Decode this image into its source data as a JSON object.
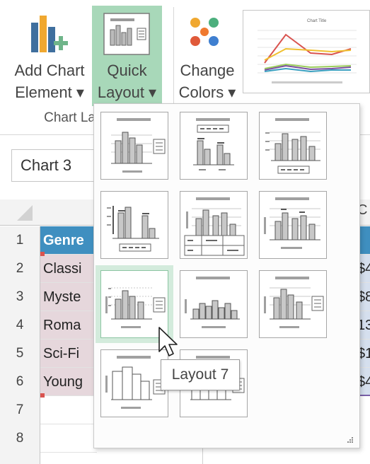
{
  "ribbon": {
    "add_chart_element": {
      "line1": "Add Chart",
      "line2": "Element ▾",
      "icon": "add-chart-element-icon"
    },
    "quick_layout": {
      "line1": "Quick",
      "line2": "Layout ▾",
      "icon": "quick-layout-icon"
    },
    "change_colors": {
      "line1": "Change",
      "line2": "Colors ▾",
      "icon": "change-colors-icon"
    },
    "group_label": "Chart La",
    "preview_title": "Chart Title",
    "accent": "#a8d8b9"
  },
  "namebox": {
    "value": "Chart 3"
  },
  "sheet": {
    "right_col_header": "C",
    "rows": [
      {
        "num": "1",
        "a": "Genre",
        "c": ""
      },
      {
        "num": "2",
        "a": "Classi",
        "c": "$4"
      },
      {
        "num": "3",
        "a": "Myste",
        "c": "$8"
      },
      {
        "num": "4",
        "a": "Roma",
        "c": "13"
      },
      {
        "num": "5",
        "a": "Sci-Fi",
        "c": "$1"
      },
      {
        "num": "6",
        "a": "Young",
        "c": "$4"
      },
      {
        "num": "7",
        "a": "",
        "c": ""
      },
      {
        "num": "8",
        "a": "",
        "c": ""
      }
    ]
  },
  "gallery": {
    "layouts": [
      "Layout 1",
      "Layout 2",
      "Layout 3",
      "Layout 4",
      "Layout 5",
      "Layout 6",
      "Layout 7",
      "Layout 8",
      "Layout 9",
      "Layout 10",
      "Layout 11"
    ],
    "hovered": "Layout 7"
  },
  "tooltip": {
    "text": "Layout 7"
  }
}
